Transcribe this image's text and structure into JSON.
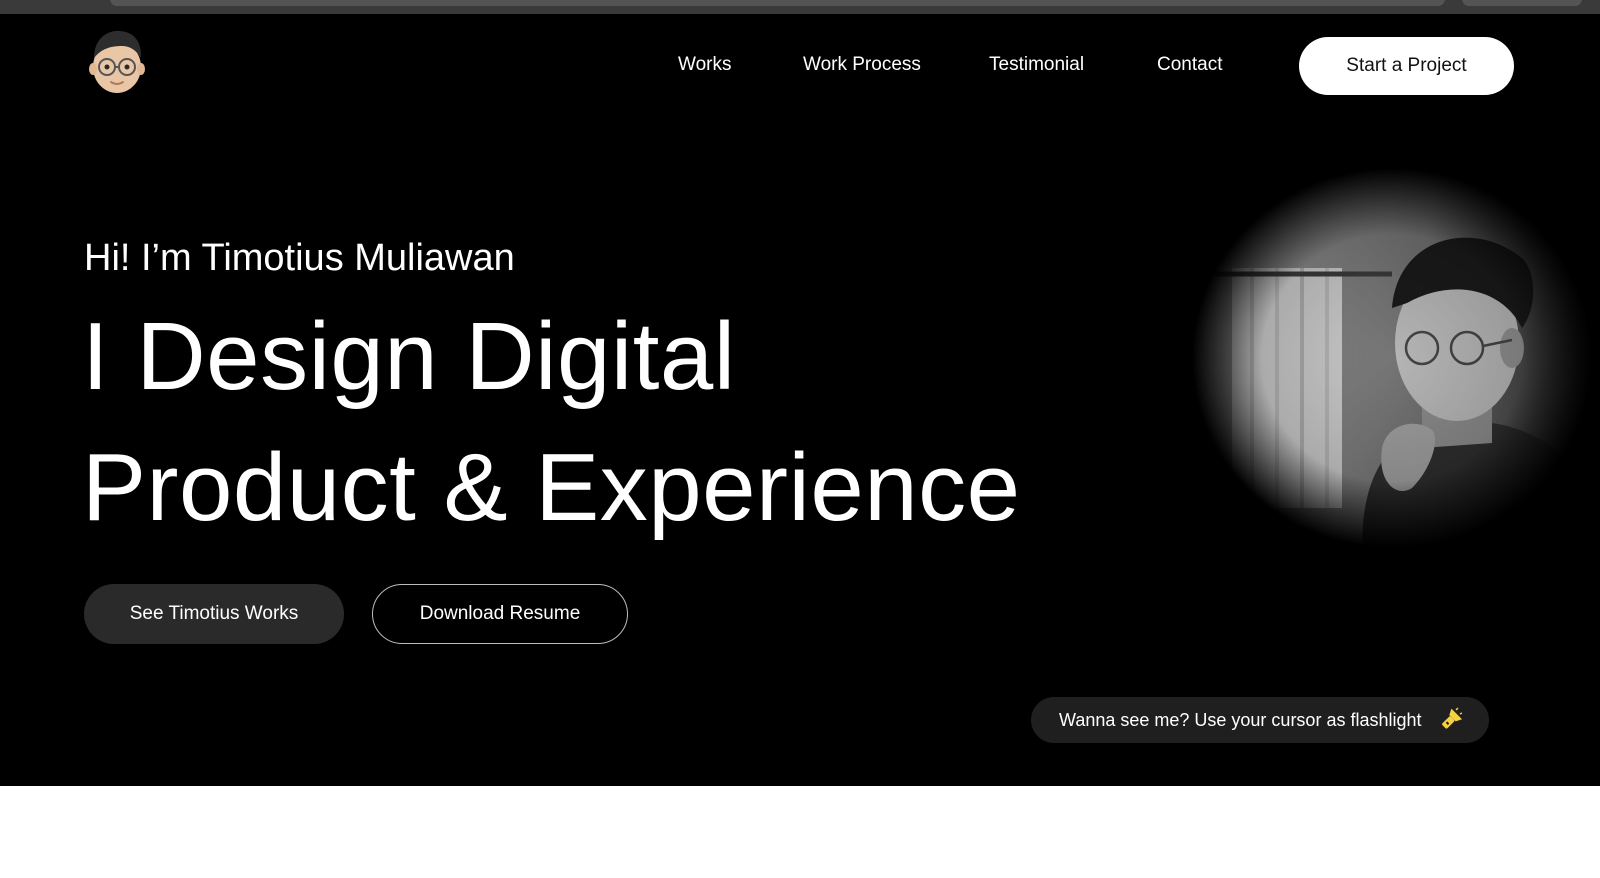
{
  "nav": {
    "items": [
      {
        "label": "Works"
      },
      {
        "label": "Work Process"
      },
      {
        "label": "Testimonial"
      },
      {
        "label": "Contact"
      }
    ],
    "cta_label": "Start a Project"
  },
  "hero": {
    "greeting": "Hi! I’m Timotius Muliawan",
    "headline_line1": "I Design Digital",
    "headline_line2": "Product & Experience",
    "primary_button": "See Timotius Works",
    "secondary_button": "Download Resume",
    "flashlight_hint": "Wanna see me? Use your cursor as flashlight"
  },
  "icons": {
    "logo": "memoji-avatar-icon",
    "flashlight": "flashlight-icon"
  },
  "colors": {
    "background": "#000000",
    "text": "#ffffff",
    "primary_button_bg": "#2a2a2a",
    "cta_bg": "#ffffff",
    "flashlight_accent": "#f5d142"
  }
}
